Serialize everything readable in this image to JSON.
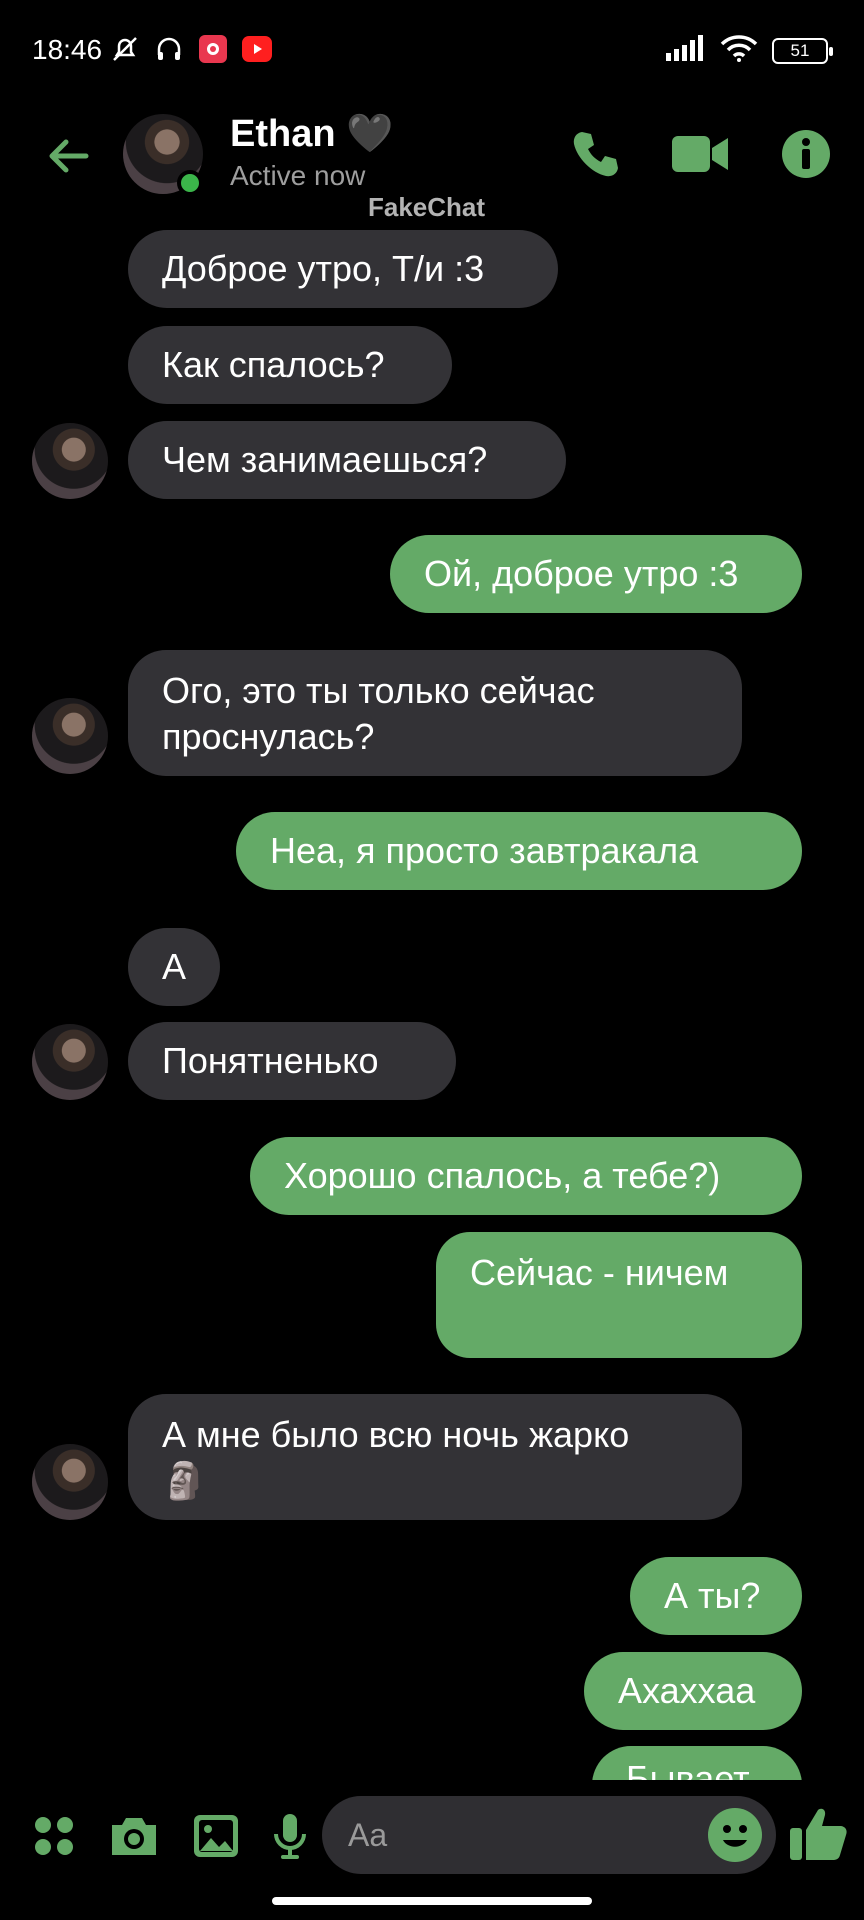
{
  "status_bar": {
    "time": "18:46",
    "battery": "51"
  },
  "header": {
    "contact_name": "Ethan 🖤",
    "status": "Active now",
    "watermark": "FakeChat"
  },
  "messages": [
    {
      "dir": "in",
      "text": "Доброе утро, Т/и :3"
    },
    {
      "dir": "in",
      "text": "Как спалось?"
    },
    {
      "dir": "in",
      "text": "Чем занимаешься?"
    },
    {
      "dir": "out",
      "text": "Ой, доброе утро :3"
    },
    {
      "dir": "in",
      "line1": "Ого, это ты только сейчас",
      "line2": "проснулась?"
    },
    {
      "dir": "out",
      "text": "Неа, я просто завтракала"
    },
    {
      "dir": "in",
      "text": "А"
    },
    {
      "dir": "in",
      "text": "Понятненько"
    },
    {
      "dir": "out",
      "text": "Хорошо спалось, а тебе?)"
    },
    {
      "dir": "out",
      "text": "Сейчас - ничем"
    },
    {
      "dir": "in",
      "line1": "А мне было всю ночь жарко",
      "line2": "🗿"
    },
    {
      "dir": "out",
      "text": "А ты?"
    },
    {
      "dir": "out",
      "text": "Ахаххаа"
    },
    {
      "dir": "out",
      "text": "Бывает"
    }
  ],
  "composer": {
    "placeholder": "Aa"
  },
  "colors": {
    "accent": "#64aa67",
    "incoming_bubble": "#333236",
    "background": "#000000"
  },
  "icons": [
    "back-arrow-icon",
    "phone-icon",
    "video-icon",
    "info-icon",
    "apps-icon",
    "camera-icon",
    "gallery-icon",
    "mic-icon",
    "emoji-icon",
    "thumbs-up-icon"
  ]
}
